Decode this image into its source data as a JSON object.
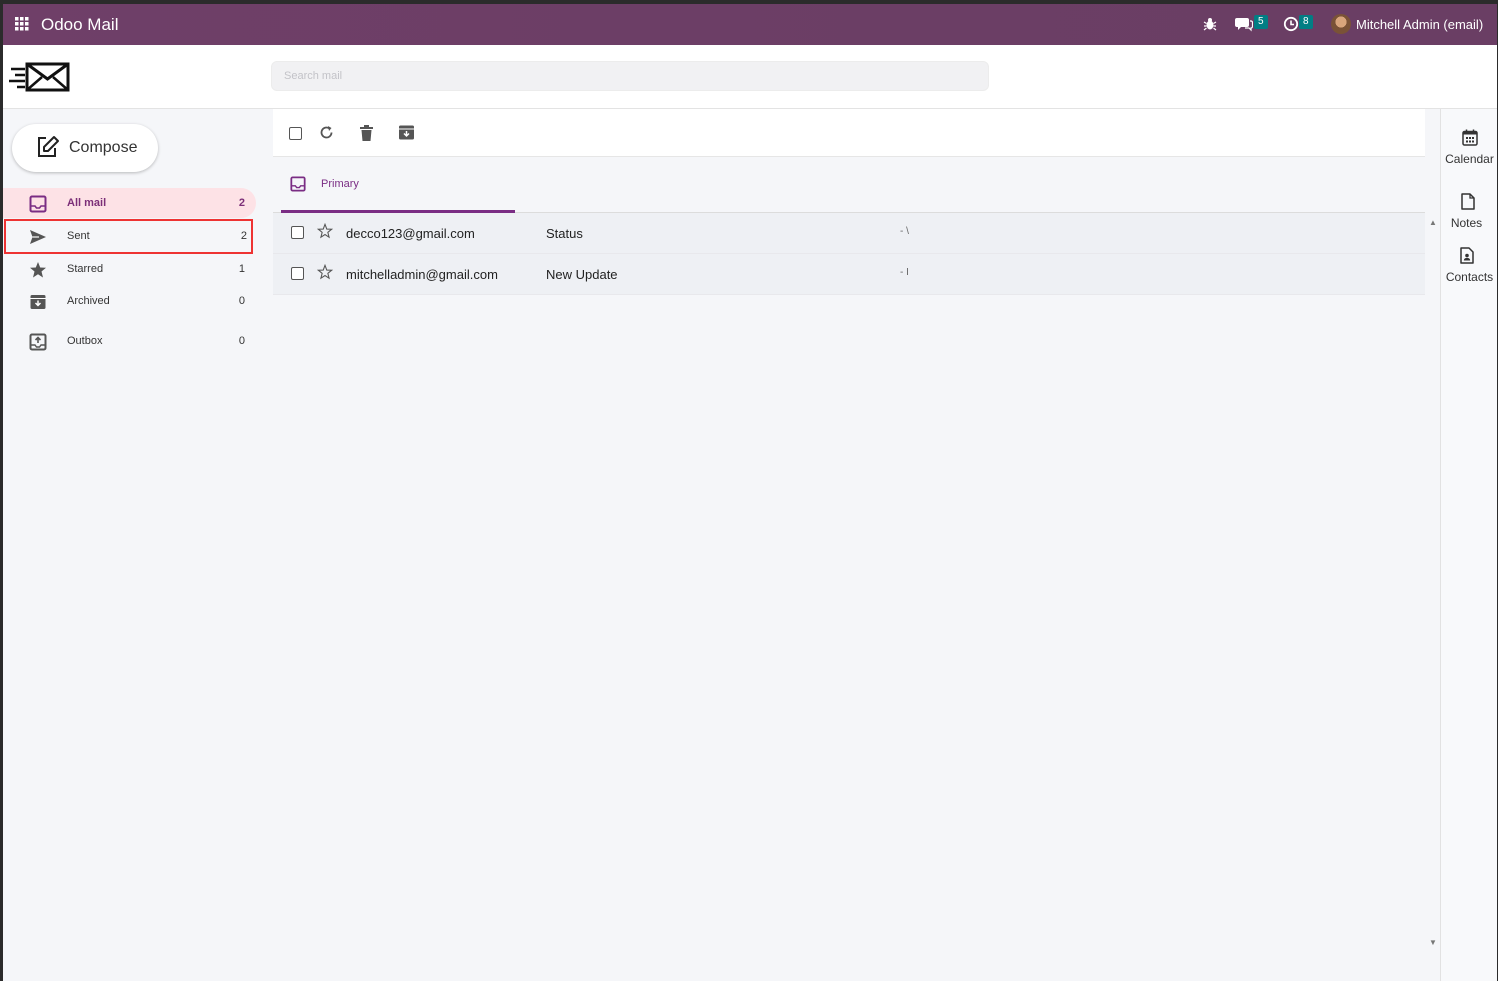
{
  "navbar": {
    "app_title": "Odoo Mail",
    "chat_badge": "5",
    "activity_badge": "8",
    "user_name": "Mitchell Admin (email)"
  },
  "header": {
    "search_placeholder": "Search mail"
  },
  "sidebar": {
    "compose_label": "Compose",
    "folders": [
      {
        "label": "All mail",
        "count": "2",
        "icon": "inbox-icon"
      },
      {
        "label": "Sent",
        "count": "2",
        "icon": "send-icon"
      },
      {
        "label": "Starred",
        "count": "1",
        "icon": "star-icon"
      },
      {
        "label": "Archived",
        "count": "0",
        "icon": "archive-icon"
      },
      {
        "label": "Outbox",
        "count": "0",
        "icon": "outbox-icon"
      }
    ]
  },
  "tabs": [
    {
      "label": "Primary",
      "icon": "inbox-icon"
    }
  ],
  "mails": [
    {
      "sender": "decco123@gmail.com",
      "subject": "Status",
      "snippet": "- \\"
    },
    {
      "sender": "mitchelladmin@gmail.com",
      "subject": "New Update",
      "snippet": "- I"
    }
  ],
  "rail": {
    "calendar_label": "Calendar",
    "notes_label": "Notes",
    "contacts_label": "Contacts"
  },
  "colors": {
    "navbar": "#6f3f68",
    "accent": "#7a2d84",
    "badge": "#017e84",
    "active_folder_bg": "#fde2e6",
    "highlight_outline": "#ee3333"
  }
}
